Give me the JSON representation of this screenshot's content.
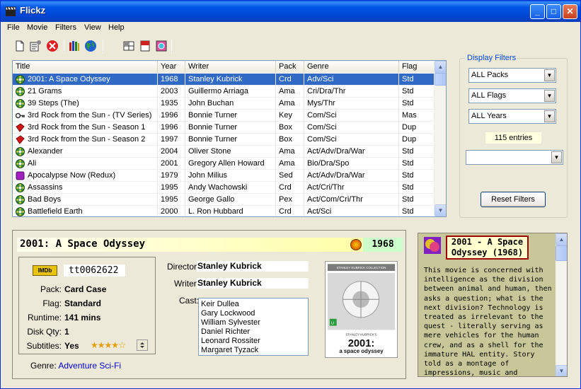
{
  "window": {
    "title": "Flickz"
  },
  "menu": [
    "File",
    "Movie",
    "Filters",
    "View",
    "Help"
  ],
  "columns": [
    "Title",
    "Year",
    "Writer",
    "Pack",
    "Genre",
    "Flag"
  ],
  "rows": [
    {
      "title": "2001: A Space Odyssey",
      "year": "1968",
      "writer": "Stanley Kubrick",
      "pack": "Crd",
      "genre": "Adv/Sci",
      "flag": "Std",
      "icon": "film-reel-icon"
    },
    {
      "title": "21 Grams",
      "year": "2003",
      "writer": "Guillermo Arriaga",
      "pack": "Ama",
      "genre": "Cri/Dra/Thr",
      "flag": "Std",
      "icon": "film-reel-icon"
    },
    {
      "title": "39 Steps (The)",
      "year": "1935",
      "writer": "John Buchan",
      "pack": "Ama",
      "genre": "Mys/Thr",
      "flag": "Std",
      "icon": "film-reel-icon"
    },
    {
      "title": "3rd Rock from the Sun - (TV Series)",
      "year": "1996",
      "writer": "Bonnie Turner",
      "pack": "Key",
      "genre": "Com/Sci",
      "flag": "Mas",
      "icon": "key-icon"
    },
    {
      "title": "3rd Rock from the Sun - Season 1",
      "year": "1996",
      "writer": "Bonnie Turner",
      "pack": "Box",
      "genre": "Com/Sci",
      "flag": "Dup",
      "icon": "red-box-icon"
    },
    {
      "title": "3rd Rock from the Sun - Season 2",
      "year": "1997",
      "writer": "Bonnie Turner",
      "pack": "Box",
      "genre": "Com/Sci",
      "flag": "Dup",
      "icon": "red-box-icon"
    },
    {
      "title": "Alexander",
      "year": "2004",
      "writer": "Oliver Stone",
      "pack": "Ama",
      "genre": "Act/Adv/Dra/War",
      "flag": "Std",
      "icon": "film-reel-icon"
    },
    {
      "title": "Ali",
      "year": "2001",
      "writer": "Gregory Allen Howard",
      "pack": "Ama",
      "genre": "Bio/Dra/Spo",
      "flag": "Std",
      "icon": "film-reel-icon"
    },
    {
      "title": "Apocalypse Now (Redux)",
      "year": "1979",
      "writer": "John Milius",
      "pack": "Sed",
      "genre": "Act/Adv/Dra/War",
      "flag": "Std",
      "icon": "purple-case-icon"
    },
    {
      "title": "Assassins",
      "year": "1995",
      "writer": "Andy Wachowski",
      "pack": "Crd",
      "genre": "Act/Cri/Thr",
      "flag": "Std",
      "icon": "film-reel-icon"
    },
    {
      "title": "Bad Boys",
      "year": "1995",
      "writer": "George Gallo",
      "pack": "Pex",
      "genre": "Act/Com/Cri/Thr",
      "flag": "Std",
      "icon": "film-reel-icon"
    },
    {
      "title": "Battlefield Earth",
      "year": "2000",
      "writer": "L. Ron Hubbard",
      "pack": "Crd",
      "genre": "Act/Sci",
      "flag": "Std",
      "icon": "film-reel-icon"
    }
  ],
  "filters": {
    "legend": "Display Filters",
    "packs": "ALL Packs",
    "flags": "ALL Flags",
    "years": "ALL Years",
    "entries": "115 entries",
    "extra": "",
    "reset": "Reset Filters"
  },
  "detail": {
    "title": "2001: A Space Odyssey",
    "year": "1968",
    "imdb_badge": "IMDb",
    "imdb_id": "tt0062622",
    "pack_label": "Pack:",
    "pack": "Card Case",
    "flag_label": "Flag:",
    "flag": "Standard",
    "runtime_label": "Runtime:",
    "runtime": "141 mins",
    "disk_label": "Disk Qty:",
    "disk": "1",
    "subtitles_label": "Subtitles:",
    "subtitles": "Yes",
    "rating": 4,
    "genre_label": "Genre:",
    "genres": [
      "Adventure",
      "Sci-Fi"
    ],
    "director_label": "Director:",
    "director": "Stanley Kubrick",
    "writer_label": "Writer:",
    "writer": "Stanley Kubrick",
    "cast_label": "Cast:",
    "cast": [
      "Keir Dullea",
      "Gary Lockwood",
      "William Sylvester",
      "Daniel Richter",
      "Leonard Rossiter",
      "Margaret Tyzack"
    ],
    "poster": {
      "top": "STANLEY KUBRICK COLLECTION",
      "brand": "STANLEY KUBRICK'S",
      "title": "2001:",
      "subtitle": "a space odyssey"
    }
  },
  "plot": {
    "heading": "2001 - A Space Odyssey (1968)",
    "text": "This movie is concerned with intelligence as the division between animal and human, then asks a question; what is the next division? Technology is treated as irrelevant to the quest - literally serving as mere vehicles for the human crew, and as a shell for the immature HAL entity. Story told as a montage of impressions, music and impressive and careful attention to subliminal"
  }
}
